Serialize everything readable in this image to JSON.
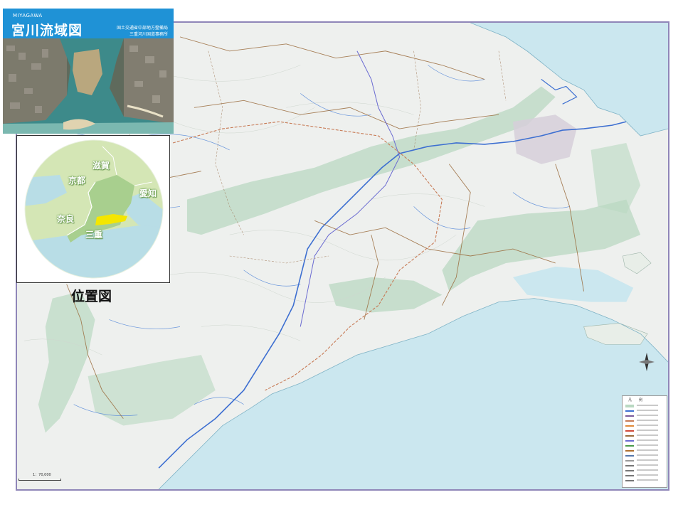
{
  "cover": {
    "english_name": "MIYAGAWA",
    "title": "宮川流域図",
    "organization_line1": "国土交通省中部地方整備局",
    "organization_line2": "三重河川国道事務所"
  },
  "location_map": {
    "caption": "位置図",
    "prefectures": {
      "shiga": "滋賀",
      "kyoto": "京都",
      "aichi": "愛知",
      "nara": "奈良",
      "mie": "三重"
    },
    "basin_color": "#f4e600",
    "land_color": "#d4e6b5",
    "sea_color": "#b8dde6"
  },
  "legend": {
    "title": "凡　　例"
  },
  "scale": {
    "label": "1：70,000"
  },
  "colors": {
    "sea": "#cbe7ef",
    "land": "#eef0ee",
    "forest_belt": "#b9d8c2",
    "river": "#3d6fd1",
    "road": "#9a6b3c",
    "boundary": "#7a5a9a",
    "frame": "#8f86b8"
  },
  "icons": {
    "compass": "north-arrow-icon"
  }
}
